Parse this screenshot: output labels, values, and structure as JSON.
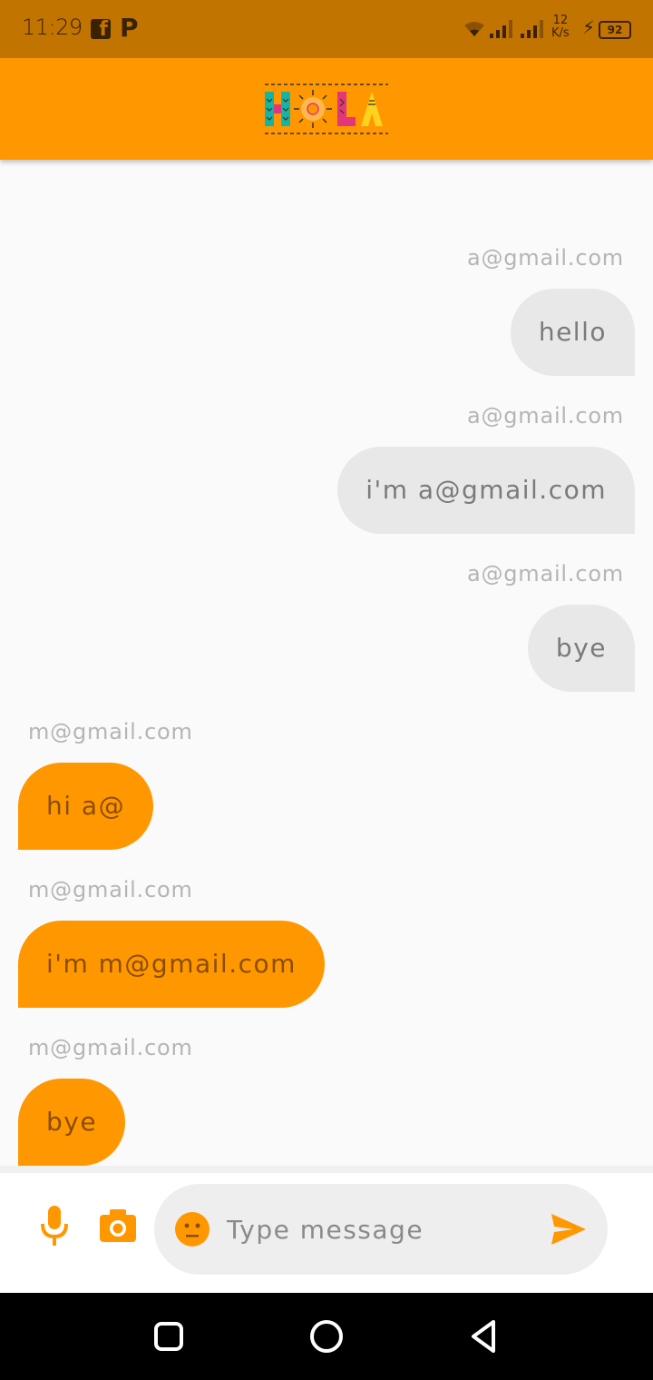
{
  "status_bar": {
    "time": "11:29",
    "net_speed_value": "12",
    "net_speed_unit": "K/s",
    "battery": "92",
    "icons": [
      "facebook-icon",
      "p-app-icon",
      "wifi-icon",
      "signal-icon",
      "signal-icon",
      "charging-icon",
      "battery-icon"
    ]
  },
  "app_bar": {
    "logo_text": "HOLA"
  },
  "messages": [
    {
      "sender": "a@gmail.com",
      "text": "hello",
      "side": "right"
    },
    {
      "sender": "a@gmail.com",
      "text": "i'm a@gmail.com",
      "side": "right"
    },
    {
      "sender": "a@gmail.com",
      "text": "bye",
      "side": "right"
    },
    {
      "sender": "m@gmail.com",
      "text": "hi a@",
      "side": "left"
    },
    {
      "sender": "m@gmail.com",
      "text": "i'm m@gmail.com",
      "side": "left"
    },
    {
      "sender": "m@gmail.com",
      "text": "bye",
      "side": "left"
    }
  ],
  "composer": {
    "placeholder": "Type message",
    "value": ""
  },
  "colors": {
    "accent": "#ff9800",
    "status_bar": "#c27400",
    "my_bubble": "#e8e8e8",
    "their_bubble": "#ff9800"
  }
}
